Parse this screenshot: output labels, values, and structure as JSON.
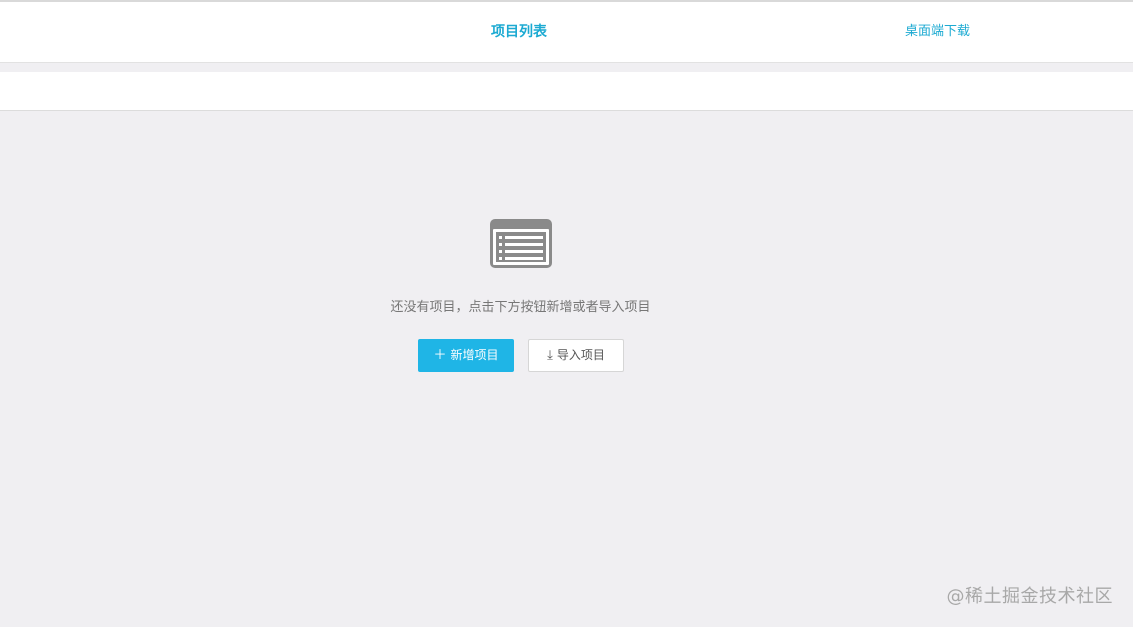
{
  "nav": {
    "title": "项目列表",
    "download": "桌面端下载"
  },
  "empty_state": {
    "icon": "list-icon",
    "message": "还没有项目，点击下方按钮新增或者导入项目"
  },
  "actions": {
    "add_icon": "＋",
    "add_label": "新增项目",
    "import_icon": "⤓",
    "import_label": "导入项目"
  },
  "watermark": "@稀土掘金技术社区",
  "colors": {
    "accent": "#1caad2",
    "button_primary": "#1fb5e6",
    "background": "#f0eff2",
    "icon_gray": "#8a8a8a"
  }
}
